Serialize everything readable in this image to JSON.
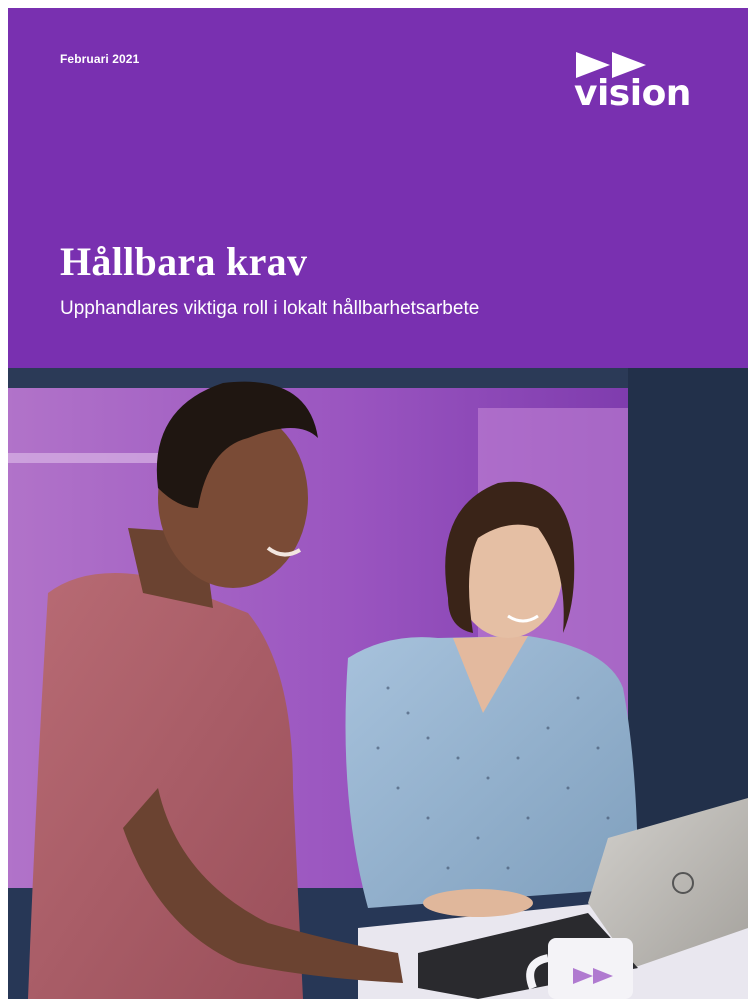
{
  "cover": {
    "date": "Februari 2021",
    "title": "Hållbara krav",
    "subtitle": "Upphandlares viktiga roll i lokalt hållbarhetsarbete"
  },
  "logo": {
    "text": "vision",
    "icon": "double-arrow-icon"
  },
  "photo": {
    "subject": "two-people-at-laptop-photo"
  },
  "colors": {
    "brand_purple": "#7930b0",
    "text_white": "#ffffff"
  }
}
